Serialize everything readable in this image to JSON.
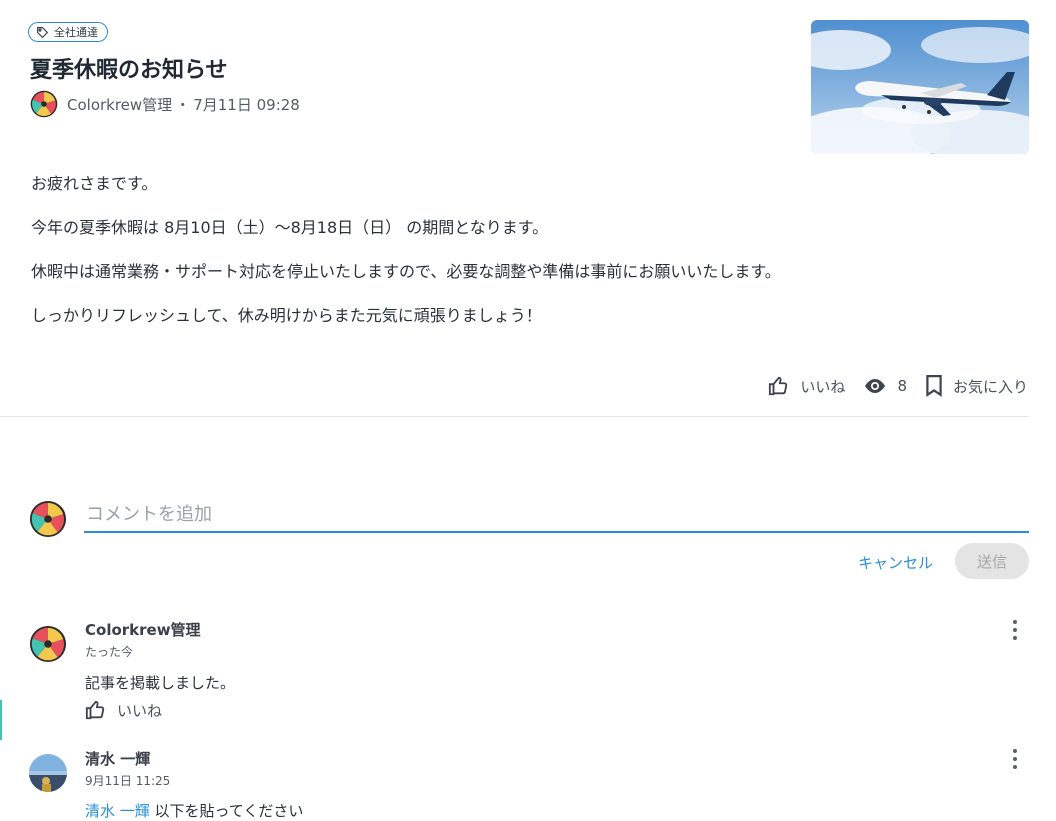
{
  "post": {
    "tag": "全社通達",
    "title": "夏季休暇のお知らせ",
    "author": "Colorkrew管理",
    "separator": "・",
    "date": "7月11日 09:28",
    "paragraphs": [
      "お疲れさまです。",
      "今年の夏季休暇は 8月10日（土）〜8月18日（日） の期間となります。",
      "休暇中は通常業務・サポート対応を停止いたしますので、必要な調整や準備は事前にお願いいたします。",
      "しっかりリフレッシュして、休み明けからまた元気に頑張りましょう！"
    ],
    "actions": {
      "like_label": "いいね",
      "views_count": "8",
      "bookmark_label": "お気に入り"
    }
  },
  "comment_form": {
    "placeholder": "コメントを追加",
    "cancel_label": "キャンセル",
    "send_label": "送信"
  },
  "comments": [
    {
      "author": "Colorkrew管理",
      "time": "たった今",
      "text": "記事を掲載しました。",
      "like_label": "いいね"
    },
    {
      "author": "清水 一輝",
      "time": "9月11日 11:25",
      "mention": "清水 一輝",
      "text": " 以下を貼ってください"
    }
  ],
  "colors": {
    "accent": "#2a8fd6",
    "text": "#2b313a"
  }
}
